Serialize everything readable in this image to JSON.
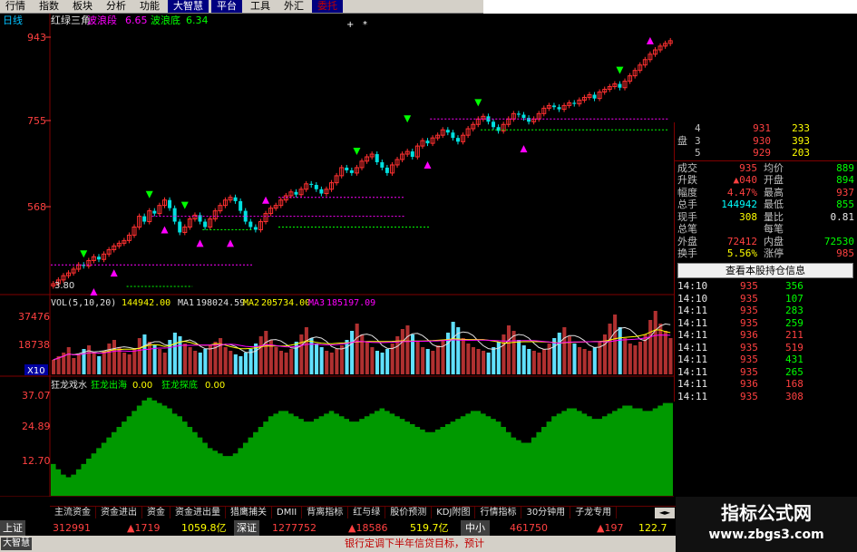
{
  "menu": [
    {
      "label": "行情",
      "hl": false,
      "red": false
    },
    {
      "label": "指数",
      "hl": false,
      "red": false
    },
    {
      "label": "板块",
      "hl": false,
      "red": false
    },
    {
      "label": "分析",
      "hl": false,
      "red": false
    },
    {
      "label": "功能",
      "hl": false,
      "red": false
    },
    {
      "label": "大智慧",
      "hl": true,
      "red": false
    },
    {
      "label": "平台",
      "hl": true,
      "red": false
    },
    {
      "label": "工具",
      "hl": false,
      "red": false
    },
    {
      "label": "外汇",
      "hl": false,
      "red": false
    },
    {
      "label": "委托",
      "hl": true,
      "red": true
    }
  ],
  "period_label": "日线",
  "indicator_title": "红绿三角",
  "indicator_val1_label": "波浪段",
  "indicator_val1": "6.65",
  "indicator_val2_label": "波浪底",
  "indicator_val2": "6.34",
  "price_axis": [
    "943",
    "755",
    "568"
  ],
  "low_label": "3.80",
  "vol_header": {
    "name": "VOL(5,10,20)",
    "v": "144942.00",
    "ma1_label": "MA1",
    "ma1": "198024.59",
    "ma2_label": "MA2",
    "ma2": "205734.00",
    "ma3_label": "MA3",
    "ma3": "185197.09"
  },
  "vol_axis": [
    "37476",
    "18738"
  ],
  "vol_scale": "X10",
  "ind2_header": {
    "name": "狂龙戏水",
    "l1": "狂龙出海",
    "v1": "0.00",
    "l2": "狂龙探底",
    "v2": "0.00"
  },
  "ind2_axis": [
    "37.07",
    "24.89",
    "12.70"
  ],
  "order_book": [
    {
      "label": "",
      "idx": "4",
      "price": "931",
      "vol": "233"
    },
    {
      "label": "盘",
      "idx": "3",
      "price": "930",
      "vol": "393"
    },
    {
      "label": "",
      "idx": "5",
      "price": "929",
      "vol": "203"
    }
  ],
  "stats": [
    {
      "l1": "成交",
      "v1": "935",
      "c1": "red",
      "l2": "均价",
      "v2": "889",
      "c2": "green"
    },
    {
      "l1": "升跌",
      "v1": "▲040",
      "c1": "red",
      "l2": "开盘",
      "v2": "894",
      "c2": "green"
    },
    {
      "l1": "幅度",
      "v1": "4.47%",
      "c1": "red",
      "l2": "最高",
      "v2": "937",
      "c2": "red"
    },
    {
      "l1": "总手",
      "v1": "144942",
      "c1": "cyan",
      "l2": "最低",
      "v2": "855",
      "c2": "green"
    },
    {
      "l1": "现手",
      "v1": "308",
      "c1": "yellow",
      "l2": "量比",
      "v2": "0.81",
      "c2": "white"
    },
    {
      "l1": "总笔",
      "v1": "",
      "c1": "white",
      "l2": "每笔",
      "v2": "",
      "c2": "white"
    },
    {
      "l1": "外盘",
      "v1": "72412",
      "c1": "red",
      "l2": "内盘",
      "v2": "72530",
      "c2": "green"
    },
    {
      "l1": "换手",
      "v1": "5.56%",
      "c1": "yellow",
      "l2": "涨停",
      "v2": "985",
      "c2": "red"
    }
  ],
  "holdings_btn": "查看本股持仓信息",
  "ticks": [
    {
      "t": "14:10",
      "p": "935",
      "v": "356",
      "red": false
    },
    {
      "t": "14:10",
      "p": "935",
      "v": "107",
      "red": false
    },
    {
      "t": "14:11",
      "p": "935",
      "v": "283",
      "red": false
    },
    {
      "t": "14:11",
      "p": "935",
      "v": "259",
      "red": false
    },
    {
      "t": "14:11",
      "p": "936",
      "v": "211",
      "red": true
    },
    {
      "t": "14:11",
      "p": "935",
      "v": "519",
      "red": true
    },
    {
      "t": "14:11",
      "p": "935",
      "v": "431",
      "red": false
    },
    {
      "t": "14:11",
      "p": "935",
      "v": "265",
      "red": false
    },
    {
      "t": "14:11",
      "p": "936",
      "v": "168",
      "red": true
    },
    {
      "t": "14:11",
      "p": "935",
      "v": "308",
      "red": true
    }
  ],
  "tabs": [
    "主流资金",
    "资金进出",
    "资金",
    "资金进出量",
    "猎鹰捕关",
    "DMII",
    "背离指标",
    "红与绿",
    "股价预测",
    "KDJ附图",
    "行情指标",
    "30分钟用",
    "子龙专用"
  ],
  "status": {
    "sh_label": "上证",
    "sh_idx": "312991",
    "sh_chg": "▲1719",
    "sh_amt": "1059.8亿",
    "sz_label": "深证",
    "sz_idx": "1277752",
    "sz_chg": "▲18586",
    "sz_amt": "519.7亿",
    "zx_label": "中小",
    "zx_idx": "461750",
    "zx_chg": "▲197",
    "zx_amt": "122.7"
  },
  "app_label": "大智慧",
  "marquee": "银行定调下半年信贷目标，预计",
  "watermark": {
    "title": "指标公式网",
    "url": "www.zbgs3.com"
  },
  "colors": {
    "up": "#ff3030",
    "down": "#00e0e0",
    "green_area": "#009900",
    "magenta": "#ff00ff",
    "lime": "#00ff00"
  },
  "chart_data": {
    "type": "candlestick",
    "price_range": [
      470,
      960
    ],
    "closes": [
      485,
      492,
      500,
      505,
      512,
      520,
      518,
      528,
      535,
      530,
      540,
      548,
      555,
      560,
      565,
      575,
      590,
      610,
      600,
      620,
      615,
      630,
      640,
      625,
      600,
      580,
      590,
      605,
      612,
      600,
      590,
      605,
      620,
      630,
      640,
      645,
      638,
      620,
      600,
      590,
      585,
      600,
      615,
      625,
      630,
      640,
      648,
      655,
      650,
      660,
      670,
      668,
      660,
      652,
      660,
      672,
      685,
      700,
      695,
      690,
      700,
      712,
      720,
      725,
      710,
      700,
      690,
      705,
      715,
      725,
      730,
      720,
      740,
      750,
      745,
      755,
      760,
      770,
      765,
      755,
      748,
      760,
      772,
      780,
      790,
      795,
      785,
      775,
      768,
      780,
      790,
      800,
      798,
      792,
      785,
      790,
      800,
      810,
      815,
      812,
      808,
      815,
      820,
      818,
      825,
      830,
      835,
      828,
      840,
      845,
      850,
      855,
      848,
      860,
      870,
      880,
      890,
      900,
      910,
      918,
      925,
      930,
      935
    ],
    "volume_range": [
      0,
      37476
    ],
    "volumes": [
      8,
      10,
      12,
      15,
      9,
      11,
      14,
      16,
      12,
      10,
      13,
      17,
      19,
      15,
      12,
      11,
      14,
      20,
      22,
      18,
      16,
      14,
      12,
      19,
      23,
      21,
      17,
      15,
      13,
      12,
      14,
      16,
      18,
      20,
      15,
      13,
      11,
      10,
      12,
      14,
      17,
      21,
      24,
      19,
      15,
      13,
      12,
      14,
      18,
      22,
      26,
      20,
      17,
      15,
      13,
      12,
      14,
      16,
      19,
      24,
      28,
      22,
      18,
      15,
      13,
      12,
      14,
      17,
      21,
      25,
      27,
      22,
      18,
      15,
      14,
      13,
      16,
      19,
      23,
      29,
      26,
      20,
      17,
      15,
      14,
      13,
      12,
      15,
      18,
      22,
      27,
      24,
      19,
      16,
      14,
      13,
      12,
      14,
      17,
      20,
      23,
      26,
      21,
      17,
      15,
      14,
      13,
      15,
      18,
      22,
      28,
      33,
      26,
      20,
      17,
      16,
      18,
      22,
      30,
      35,
      28,
      24,
      20
    ],
    "ind2_range": [
      0,
      40
    ],
    "ind2": [
      12,
      10,
      8,
      7,
      8,
      10,
      12,
      14,
      16,
      18,
      20,
      22,
      24,
      26,
      28,
      30,
      32,
      34,
      36,
      37,
      36,
      35,
      34,
      33,
      31,
      30,
      28,
      26,
      24,
      22,
      20,
      18,
      17,
      16,
      15,
      15,
      16,
      18,
      20,
      22,
      24,
      26,
      28,
      30,
      31,
      32,
      32,
      31,
      30,
      29,
      28,
      28,
      29,
      30,
      31,
      32,
      31,
      30,
      29,
      28,
      28,
      29,
      30,
      31,
      32,
      33,
      32,
      31,
      30,
      29,
      28,
      27,
      26,
      25,
      24,
      24,
      25,
      26,
      27,
      28,
      29,
      30,
      31,
      32,
      32,
      31,
      30,
      29,
      28,
      26,
      24,
      22,
      21,
      20,
      20,
      22,
      24,
      26,
      28,
      30,
      31,
      32,
      33,
      33,
      32,
      31,
      30,
      29,
      29,
      30,
      31,
      32,
      33,
      34,
      34,
      33,
      33,
      32,
      32,
      33,
      34,
      35,
      35
    ]
  }
}
